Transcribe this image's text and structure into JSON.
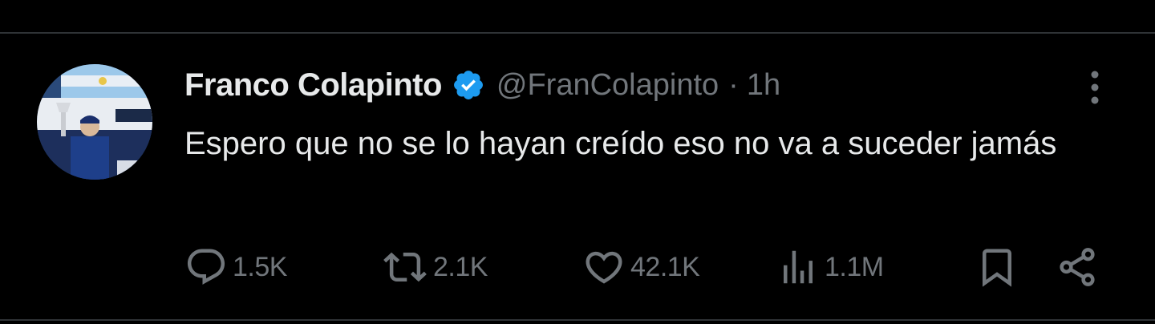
{
  "colors": {
    "background": "#000000",
    "text_primary": "#e7e9ea",
    "text_secondary": "#71767b",
    "verified_badge": "#1d9bf0",
    "divider": "#2f3336"
  },
  "tweet": {
    "author": {
      "display_name": "Franco Colapinto",
      "handle": "@FranColapinto",
      "verified": true,
      "avatar_icon": "avatar-image"
    },
    "separator": "·",
    "time": "1h",
    "text": "Espero que no se lo hayan creído eso no va a suceder jamás",
    "more_icon": "more-vertical-icon"
  },
  "actions": {
    "reply": {
      "icon": "reply-icon",
      "count": "1.5K"
    },
    "retweet": {
      "icon": "retweet-icon",
      "count": "2.1K"
    },
    "like": {
      "icon": "heart-icon",
      "count": "42.1K"
    },
    "views": {
      "icon": "views-icon",
      "count": "1.1M"
    },
    "bookmark": {
      "icon": "bookmark-icon"
    },
    "share": {
      "icon": "share-icon"
    }
  }
}
